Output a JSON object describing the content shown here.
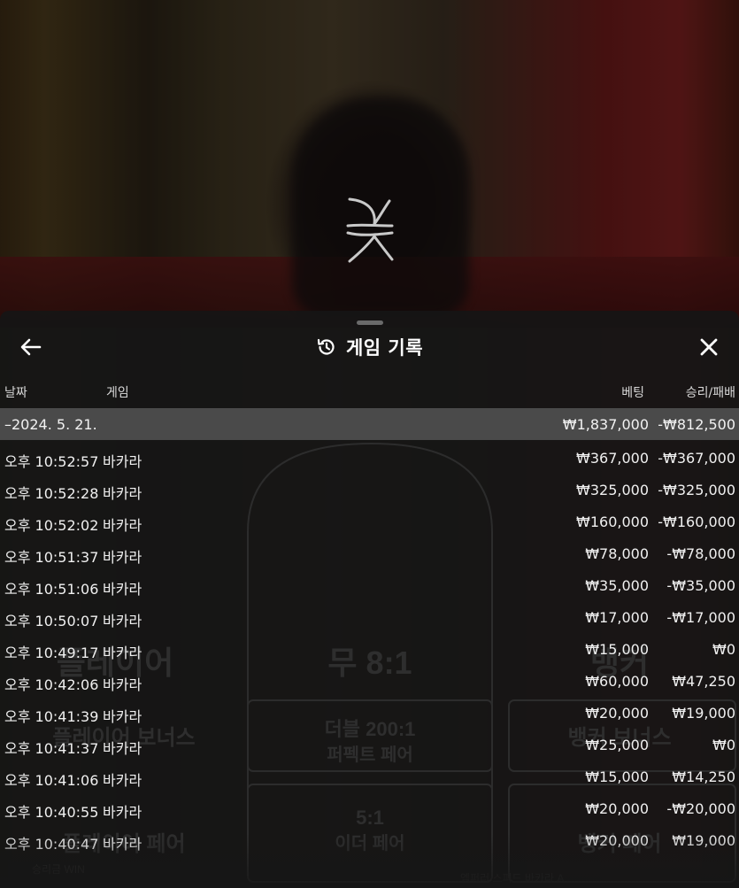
{
  "sheet": {
    "title": "게임 기록",
    "icons": {
      "back": "arrow-left-icon",
      "history": "history-icon",
      "close": "close-icon"
    }
  },
  "columns": {
    "date": "날짜",
    "game": "게임",
    "bet": "베팅",
    "result": "승리/패배"
  },
  "group": {
    "date": "–2024. 5. 21.",
    "bet": "₩1,837,000",
    "result": "-₩812,500"
  },
  "rows": [
    {
      "time": "오후 10:52:57",
      "game": "바카라",
      "bet": "₩367,000",
      "result": "-₩367,000"
    },
    {
      "time": "오후 10:52:28",
      "game": "바카라",
      "bet": "₩325,000",
      "result": "-₩325,000"
    },
    {
      "time": "오후 10:52:02",
      "game": "바카라",
      "bet": "₩160,000",
      "result": "-₩160,000"
    },
    {
      "time": "오후 10:51:37",
      "game": "바카라",
      "bet": "₩78,000",
      "result": "-₩78,000"
    },
    {
      "time": "오후 10:51:06",
      "game": "바카라",
      "bet": "₩35,000",
      "result": "-₩35,000"
    },
    {
      "time": "오후 10:50:07",
      "game": "바카라",
      "bet": "₩17,000",
      "result": "-₩17,000"
    },
    {
      "time": "오후 10:49:17",
      "game": "바카라",
      "bet": "₩15,000",
      "result": "₩0"
    },
    {
      "time": "오후 10:42:06",
      "game": "바카라",
      "bet": "₩60,000",
      "result": "₩47,250"
    },
    {
      "time": "오후 10:41:39",
      "game": "바카라",
      "bet": "₩20,000",
      "result": "₩19,000"
    },
    {
      "time": "오후 10:41:37",
      "game": "바카라",
      "bet": "₩25,000",
      "result": "₩0"
    },
    {
      "time": "오후 10:41:06",
      "game": "바카라",
      "bet": "₩15,000",
      "result": "₩14,250"
    },
    {
      "time": "오후 10:40:55",
      "game": "바카라",
      "bet": "₩20,000",
      "result": "-₩20,000"
    },
    {
      "time": "오후 10:40:47",
      "game": "바카라",
      "bet": "₩20,000",
      "result": "₩19,000"
    }
  ],
  "background_table": {
    "player": "플레이어",
    "tie": "무 8:1",
    "banker": "뱅커",
    "player_bonus": "플레이어 보너스",
    "banker_bonus": "뱅커 보너스",
    "double_ratio": "더블 200:1",
    "perfect_pair": "퍼펙트 페어",
    "either_ratio": "5:1",
    "either_pair": "이더 페어",
    "player_pair": "플레이어 페어",
    "banker_pair": "뱅커 페어",
    "win_label": "승리금 WIN",
    "table_name": "엠퍼러 스피드 바카라 A"
  }
}
